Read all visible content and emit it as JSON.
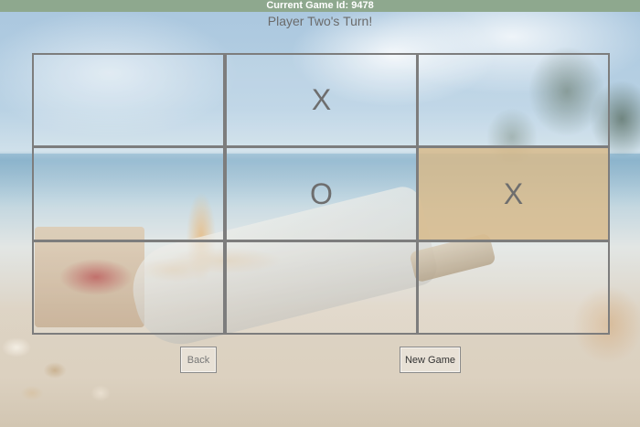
{
  "header": {
    "game_id_label": "Current Game Id: 9478"
  },
  "status": {
    "turn_text": "Player Two's Turn!"
  },
  "board": {
    "cells": [
      {
        "row": 1,
        "col": 1,
        "mark": ""
      },
      {
        "row": 1,
        "col": 2,
        "mark": "X"
      },
      {
        "row": 1,
        "col": 3,
        "mark": ""
      },
      {
        "row": 2,
        "col": 1,
        "mark": ""
      },
      {
        "row": 2,
        "col": 2,
        "mark": "O"
      },
      {
        "row": 2,
        "col": 3,
        "mark": "X",
        "highlighted": true
      },
      {
        "row": 3,
        "col": 1,
        "mark": ""
      },
      {
        "row": 3,
        "col": 2,
        "mark": ""
      },
      {
        "row": 3,
        "col": 3,
        "mark": ""
      }
    ]
  },
  "controls": {
    "back_label": "Back",
    "new_game_label": "New Game"
  },
  "colors": {
    "header_bar": "#8ea88e",
    "grid_line": "#7d7d7d",
    "highlight_cell": "#d8bb8c"
  }
}
